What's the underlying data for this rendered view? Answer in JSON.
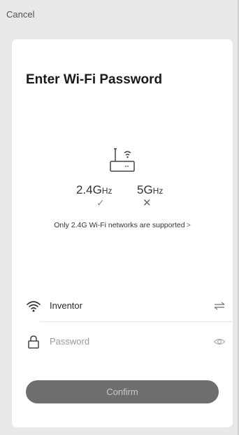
{
  "header": {
    "cancel_label": "Cancel"
  },
  "card": {
    "title": "Enter Wi-Fi Password",
    "router_icon": "router-wifi-icon",
    "bands": [
      {
        "freq": "2.4G",
        "unit": "Hz",
        "status_icon": "check-icon",
        "status_glyph": "✓"
      },
      {
        "freq": "5G",
        "unit": "Hz",
        "status_icon": "cross-icon",
        "status_glyph": "✕"
      }
    ],
    "support_note": "Only 2.4G Wi-Fi networks are supported",
    "support_chevron": ">",
    "ssid": {
      "icon": "wifi-icon",
      "value": "Inventor",
      "switch_icon": "switch-network-icon"
    },
    "password": {
      "icon": "lock-icon",
      "placeholder": "Password",
      "value": "",
      "toggle_icon": "eye-icon"
    },
    "confirm_label": "Confirm"
  },
  "colors": {
    "background": "#e8e8e8",
    "card": "#ffffff",
    "button": "#6e6e6e",
    "button_text": "#c9c9c9"
  }
}
